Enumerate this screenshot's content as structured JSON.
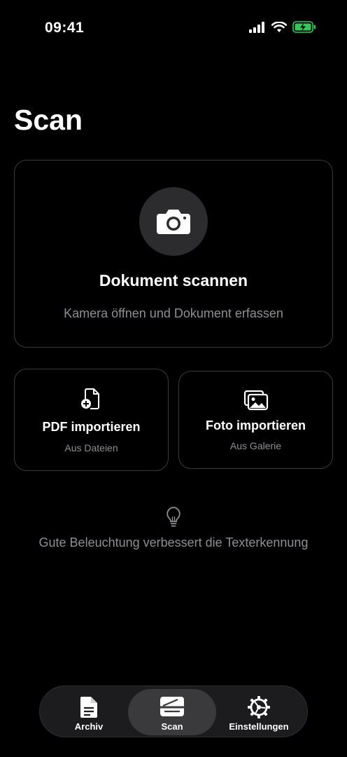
{
  "status_bar": {
    "time": "09:41"
  },
  "page": {
    "title": "Scan"
  },
  "scan_card": {
    "title": "Dokument scannen",
    "subtitle": "Kamera öffnen und Dokument erfassen",
    "icon": "camera-icon"
  },
  "pdf_card": {
    "title": "PDF importieren",
    "subtitle": "Aus Dateien",
    "icon": "file-add-icon"
  },
  "photo_card": {
    "title": "Foto importieren",
    "subtitle": "Aus Galerie",
    "icon": "photos-icon"
  },
  "tip": {
    "text": "Gute Beleuchtung verbessert die Texterkennung",
    "icon": "lightbulb-icon"
  },
  "tab_bar": {
    "tabs": [
      {
        "label": "Archiv",
        "icon": "document-icon"
      },
      {
        "label": "Scan",
        "icon": "scanner-icon",
        "active": true
      },
      {
        "label": "Einstellungen",
        "icon": "gear-icon"
      }
    ]
  },
  "colors": {
    "background": "#000000",
    "card_border": "#3a3a3c",
    "secondary_text": "#8e8e93",
    "battery": "#34c759"
  }
}
